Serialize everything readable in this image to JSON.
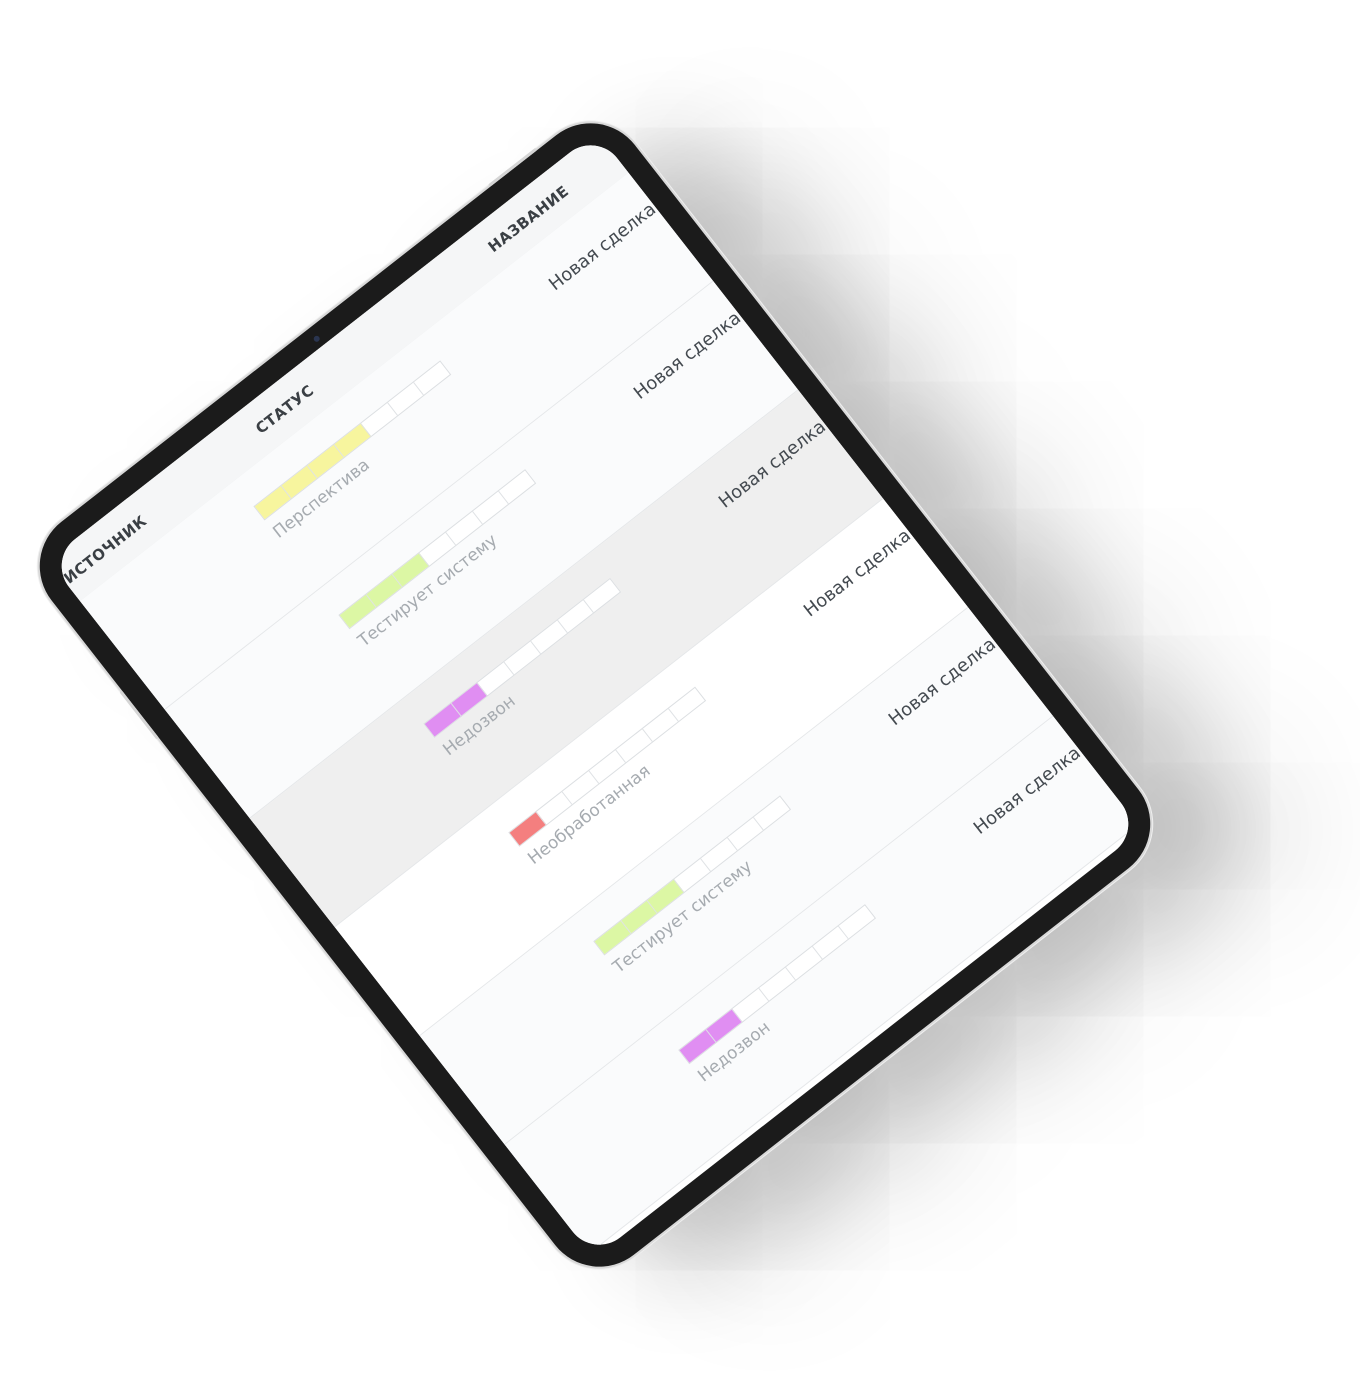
{
  "table": {
    "columns": {
      "source": "АЙТ ИСТОЧНИК",
      "status": "СТАТУС",
      "name": "НАЗВАНИЕ"
    },
    "rows": [
      {
        "name": "Новая сделка",
        "status": "Перспектива",
        "stage_filled": 4,
        "stage_total": 7,
        "color": "#f7f59e",
        "highlighted": false
      },
      {
        "name": "Новая сделка",
        "status": "Тестирует систему",
        "stage_filled": 3,
        "stage_total": 7,
        "color": "#dcf7a4",
        "highlighted": false
      },
      {
        "name": "Новая сделка",
        "status": "Недозвон",
        "stage_filled": 2,
        "stage_total": 7,
        "color": "#e08ef2",
        "highlighted": true
      },
      {
        "name": "Новая сделка",
        "status": "Необработанная",
        "stage_filled": 1,
        "stage_total": 7,
        "color": "#f47f7f",
        "highlighted": false
      },
      {
        "name": "Новая сделка",
        "status": "Тестирует систему",
        "stage_filled": 3,
        "stage_total": 7,
        "color": "#dcf7a4",
        "highlighted": false
      },
      {
        "name": "Новая сделка",
        "status": "Недозвон",
        "stage_filled": 2,
        "stage_total": 7,
        "color": "#e08ef2",
        "highlighted": false
      }
    ]
  }
}
